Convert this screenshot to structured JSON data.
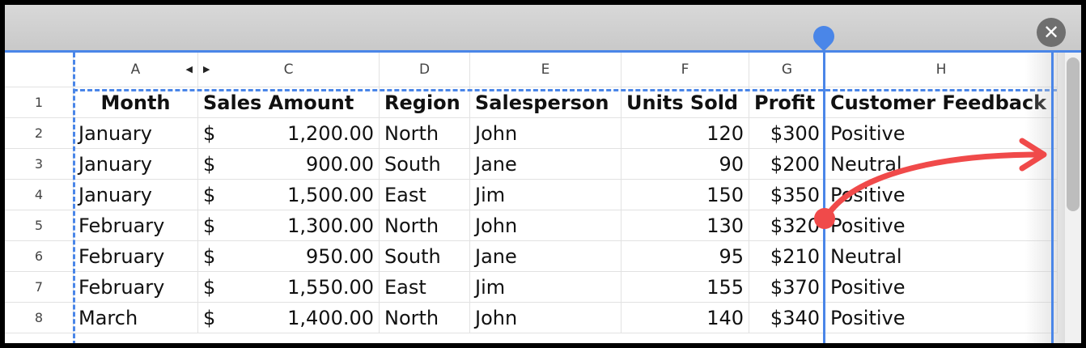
{
  "close_icon": "close-icon",
  "colors": {
    "accent": "#4a86e8",
    "annotation": "#f04a4a",
    "close_button": "#6f6f6f"
  },
  "column_headers": [
    "A",
    "C",
    "D",
    "E",
    "F",
    "G",
    "H"
  ],
  "row_numbers": [
    "1",
    "2",
    "3",
    "4",
    "5",
    "6",
    "7",
    "8"
  ],
  "header_row": {
    "month": "Month",
    "sales": "Sales Amount",
    "region": "Region",
    "salesperson": "Salesperson",
    "units": "Units Sold",
    "profit": "Profit",
    "feedback": "Customer Feedback"
  },
  "rows": [
    {
      "month": "January",
      "currency": "$",
      "sales": "1,200.00",
      "region": "North",
      "salesperson": "John",
      "units": "120",
      "profit": "$300",
      "feedback": "Positive"
    },
    {
      "month": "January",
      "currency": "$",
      "sales": "900.00",
      "region": "South",
      "salesperson": "Jane",
      "units": "90",
      "profit": "$200",
      "feedback": "Neutral"
    },
    {
      "month": "January",
      "currency": "$",
      "sales": "1,500.00",
      "region": "East",
      "salesperson": "Jim",
      "units": "150",
      "profit": "$350",
      "feedback": "Positive"
    },
    {
      "month": "February",
      "currency": "$",
      "sales": "1,300.00",
      "region": "North",
      "salesperson": "John",
      "units": "130",
      "profit": "$320",
      "feedback": "Positive"
    },
    {
      "month": "February",
      "currency": "$",
      "sales": "950.00",
      "region": "South",
      "salesperson": "Jane",
      "units": "95",
      "profit": "$210",
      "feedback": "Neutral"
    },
    {
      "month": "February",
      "currency": "$",
      "sales": "1,550.00",
      "region": "East",
      "salesperson": "Jim",
      "units": "155",
      "profit": "$370",
      "feedback": "Positive"
    },
    {
      "month": "March",
      "currency": "$",
      "sales": "1,400.00",
      "region": "North",
      "salesperson": "John",
      "units": "140",
      "profit": "$340",
      "feedback": "Positive"
    }
  ]
}
